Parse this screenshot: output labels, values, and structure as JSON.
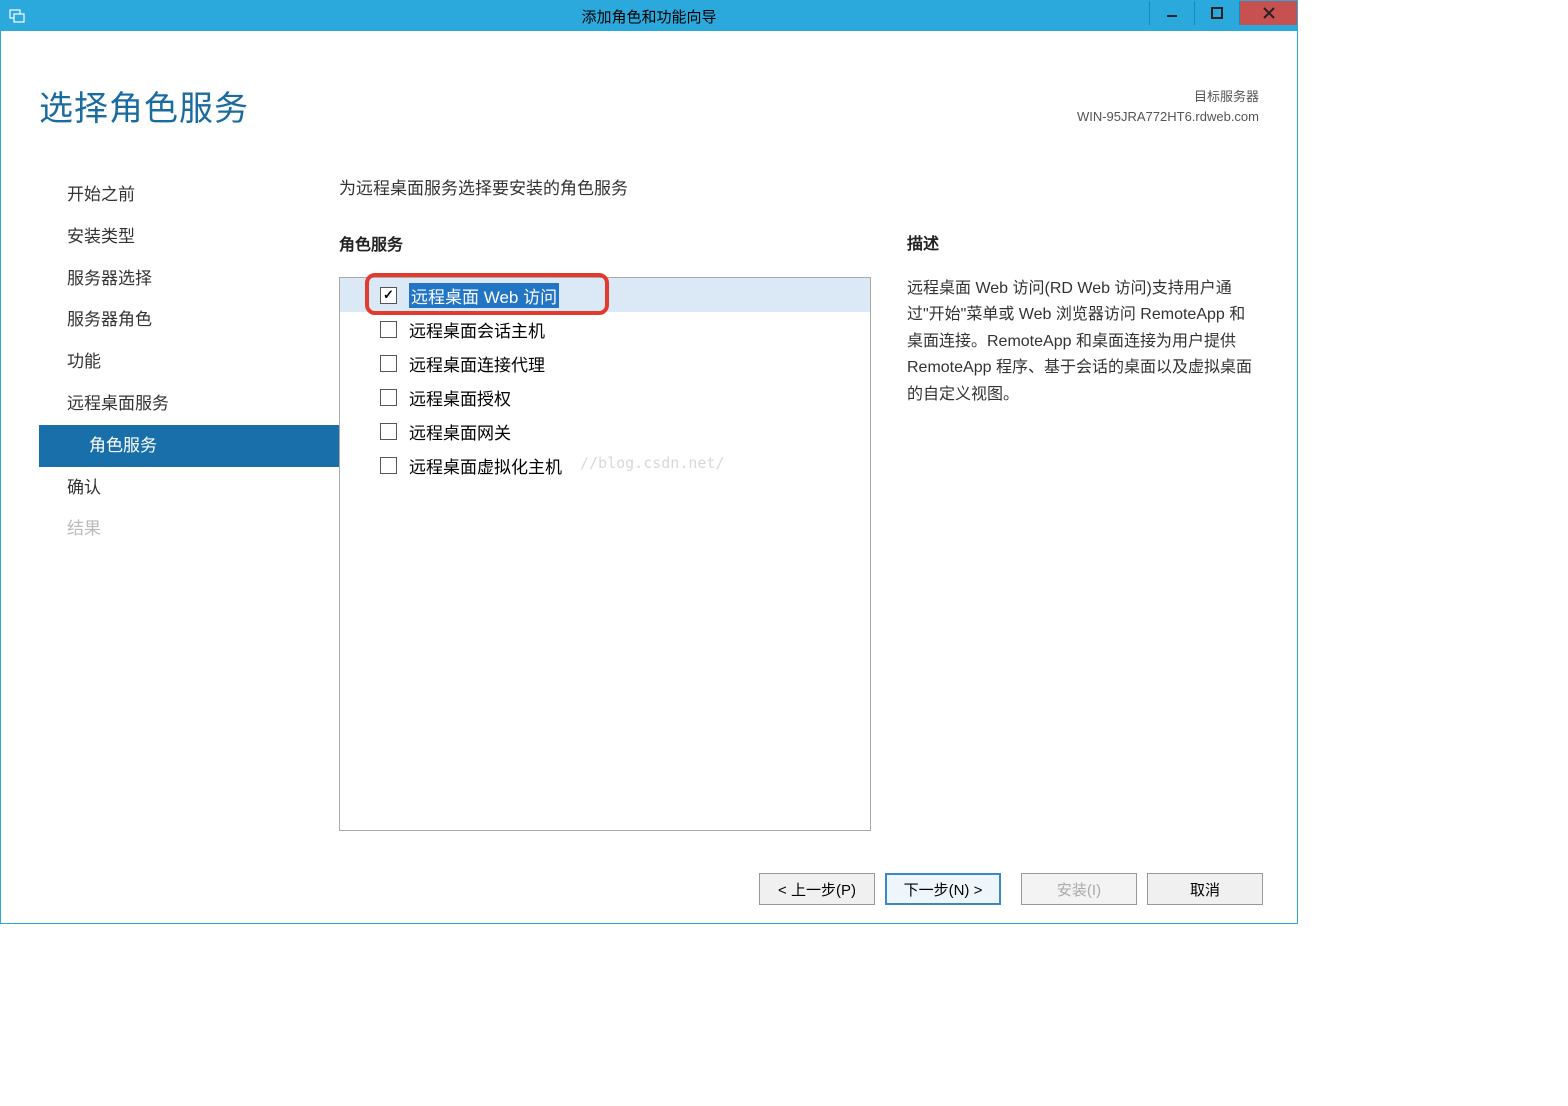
{
  "titlebar": {
    "title": "添加角色和功能向导"
  },
  "header": {
    "page_title": "选择角色服务",
    "target_label": "目标服务器",
    "target_server": "WIN-95JRA772HT6.rdweb.com"
  },
  "sidebar": {
    "items": [
      {
        "label": "开始之前",
        "state": "normal"
      },
      {
        "label": "安装类型",
        "state": "normal"
      },
      {
        "label": "服务器选择",
        "state": "normal"
      },
      {
        "label": "服务器角色",
        "state": "normal"
      },
      {
        "label": "功能",
        "state": "normal"
      },
      {
        "label": "远程桌面服务",
        "state": "normal"
      },
      {
        "label": "角色服务",
        "state": "selected",
        "sub": true
      },
      {
        "label": "确认",
        "state": "normal"
      },
      {
        "label": "结果",
        "state": "disabled"
      }
    ]
  },
  "main": {
    "instruction": "为远程桌面服务选择要安装的角色服务",
    "section_label": "角色服务",
    "roles": [
      {
        "label": "远程桌面 Web 访问",
        "checked": true,
        "highlighted": true
      },
      {
        "label": "远程桌面会话主机",
        "checked": false,
        "highlighted": false
      },
      {
        "label": "远程桌面连接代理",
        "checked": false,
        "highlighted": false
      },
      {
        "label": "远程桌面授权",
        "checked": false,
        "highlighted": false
      },
      {
        "label": "远程桌面网关",
        "checked": false,
        "highlighted": false
      },
      {
        "label": "远程桌面虚拟化主机",
        "checked": false,
        "highlighted": false
      }
    ]
  },
  "description": {
    "label": "描述",
    "text": "远程桌面 Web 访问(RD Web 访问)支持用户通过\"开始\"菜单或 Web 浏览器访问 RemoteApp 和桌面连接。RemoteApp 和桌面连接为用户提供 RemoteApp 程序、基于会话的桌面以及虚拟桌面的自定义视图。"
  },
  "footer": {
    "prev": "< 上一步(P)",
    "next": "下一步(N) >",
    "install": "安装(I)",
    "cancel": "取消"
  },
  "watermark": "//blog.csdn.net/"
}
